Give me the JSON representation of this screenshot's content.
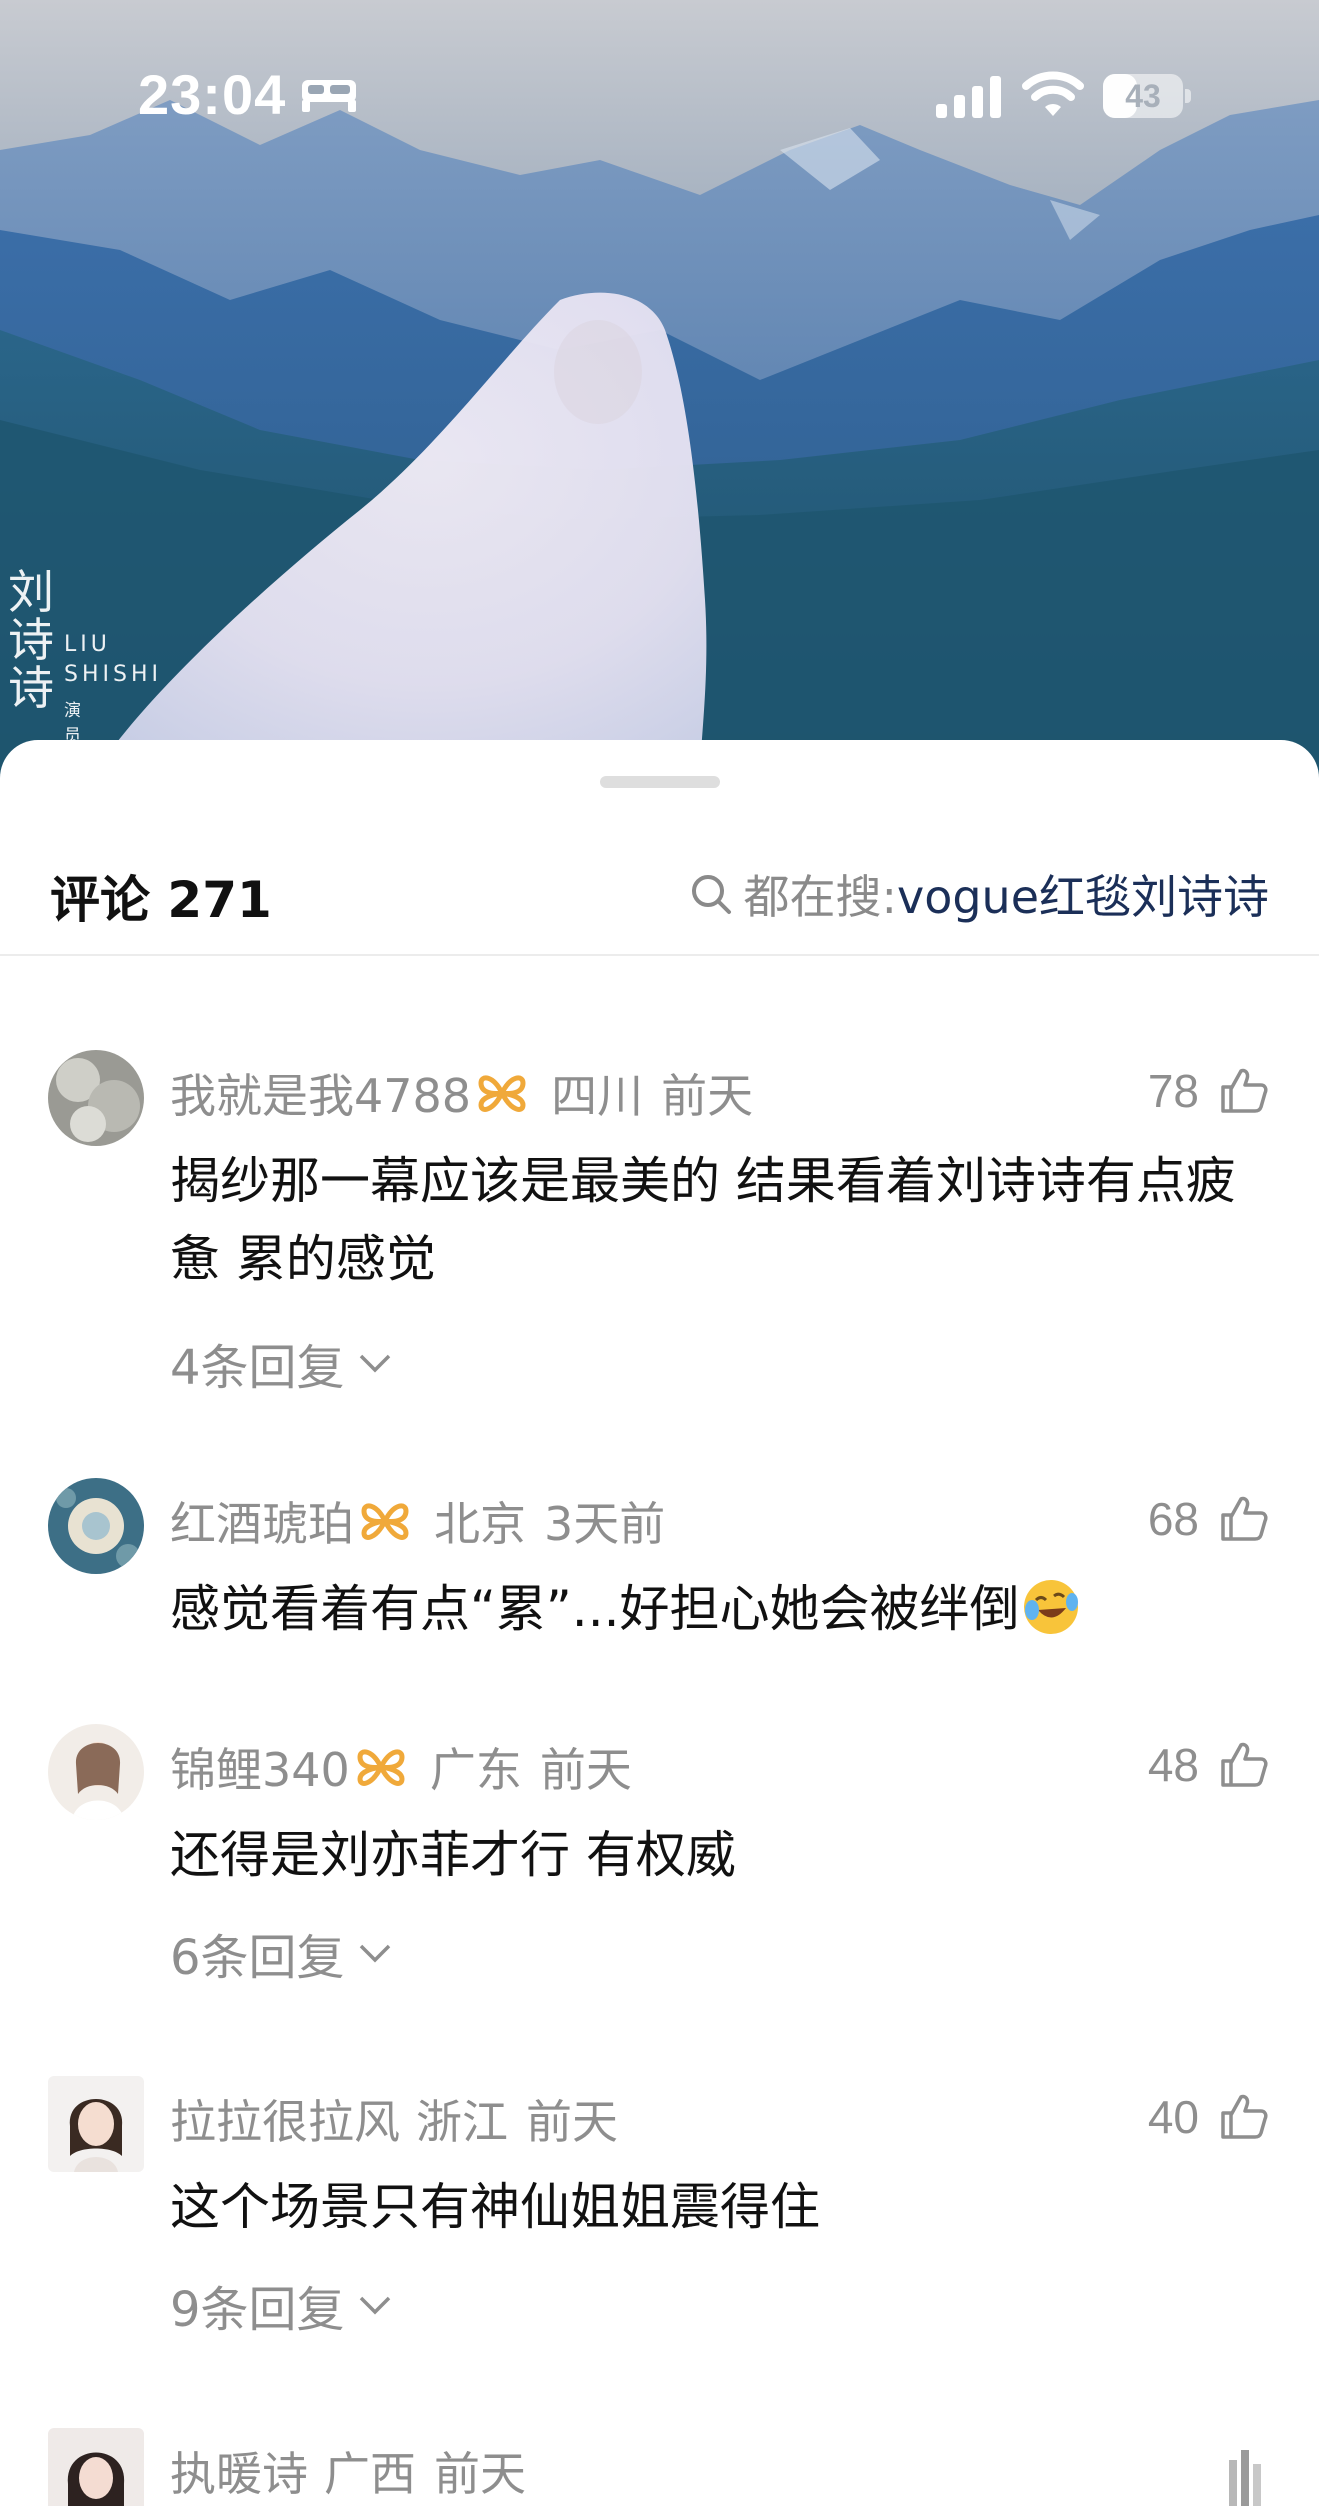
{
  "status_bar": {
    "time": "23:04",
    "battery_level": "43",
    "sleep_icon": "bed-icon",
    "signal_icon": "cellular-signal-icon",
    "wifi_icon": "wifi-icon"
  },
  "video": {
    "watermark_cn": "刘诗诗",
    "watermark_en": "LIU\nSHISHI",
    "watermark_role": "演员"
  },
  "header": {
    "title": "评论 271",
    "search_prefix": "都在搜:",
    "search_keyword": "vogue红毯刘诗诗",
    "search_icon": "search-icon"
  },
  "comments": [
    {
      "name": "我就是我4788",
      "badge": "fan-badge-icon",
      "location": "四川",
      "time": "前天",
      "likes": "78",
      "text": "揭纱那一幕应该是最美的 结果看着刘诗诗有点疲惫 累的感觉",
      "replies": "4条回复"
    },
    {
      "name": "红酒琥珀",
      "badge": "fan-badge-icon",
      "location": "北京",
      "time": "3天前",
      "likes": "68",
      "text": "感觉看着有点“累”...好担心她会被绊倒",
      "emoji": "laughing-crying-emoji",
      "replies": ""
    },
    {
      "name": "锦鲤340",
      "badge": "fan-badge-icon",
      "location": "广东",
      "time": "前天",
      "likes": "48",
      "text": "还得是刘亦菲才行 有权威",
      "replies": "6条回复"
    },
    {
      "name": "拉拉很拉风",
      "location": "浙江",
      "time": "前天",
      "likes": "40",
      "text": "这个场景只有神仙姐姐震得住",
      "replies": "9条回复"
    },
    {
      "name": "执暖诗",
      "location": "广西",
      "time": "前天"
    }
  ],
  "colors": {
    "meta_gray": "#8e8e8e",
    "keyword_navy": "#1b2f58",
    "badge_gold": "#f0a93a",
    "body_text": "#111111"
  }
}
